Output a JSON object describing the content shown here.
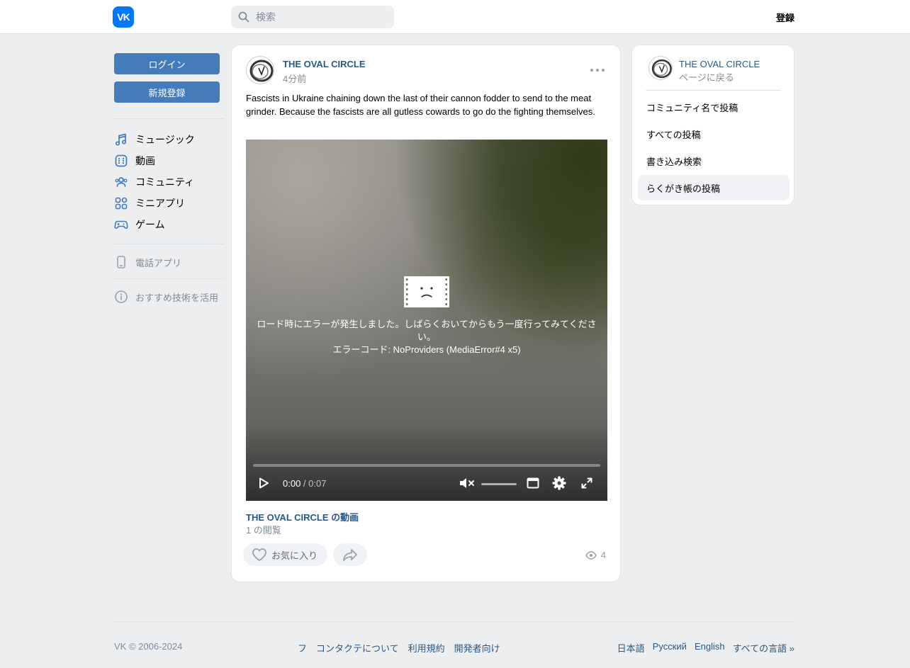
{
  "colors": {
    "accent": "#447bba",
    "link": "#2a5885",
    "muted": "#818c99",
    "brand": "#0077ff"
  },
  "header": {
    "logo_text": "VK",
    "search_placeholder": "検索",
    "signup_label": "登録"
  },
  "sidebar": {
    "login_label": "ログイン",
    "register_label": "新規登録",
    "items": [
      {
        "label": "ミュージック",
        "icon": "music-note-icon"
      },
      {
        "label": "動画",
        "icon": "video-icon"
      },
      {
        "label": "コミュニティ",
        "icon": "users-icon"
      },
      {
        "label": "ミニアプリ",
        "icon": "apps-icon"
      },
      {
        "label": "ゲーム",
        "icon": "gamepad-icon"
      }
    ],
    "phone_app_label": "電話アプリ",
    "tech_label": "おすすめ技術を活用"
  },
  "post": {
    "author": "THE OVAL CIRCLE",
    "time": "4分前",
    "text": "Fascists in Ukraine chaining down the last of their cannon fodder to send to the meat grinder. Because the fascists are all gutless cowards to go do the fighting themselves.",
    "video": {
      "error_message": "ロード時にエラーが発生しました。しばらくおいてからもう一度行ってみてください。",
      "error_code": "エラーコード: NoProviders (MediaError#4 x5)",
      "current_time": "0:00",
      "separator": " / ",
      "duration": "0:07",
      "progress": 0,
      "muted": true
    },
    "video_title": "THE OVAL CIRCLE の動画",
    "video_views": "1 の閲覧",
    "like_label": "お気に入り",
    "view_count": "4"
  },
  "side": {
    "name": "THE OVAL CIRCLE",
    "back_label": "ページに戻る",
    "items": [
      {
        "label": "コミュニティ名で投稿",
        "active": false
      },
      {
        "label": "すべての投稿",
        "active": false
      },
      {
        "label": "書き込み検索",
        "active": false
      },
      {
        "label": "らくがき帳の投稿",
        "active": true
      }
    ]
  },
  "footer": {
    "copyright": "VK © 2006-2024",
    "links": [
      "フ",
      "コンタクテについて",
      "利用規約",
      "開発者向け"
    ],
    "languages": [
      "日本語",
      "Русский",
      "English",
      "すべての言語 »"
    ]
  }
}
